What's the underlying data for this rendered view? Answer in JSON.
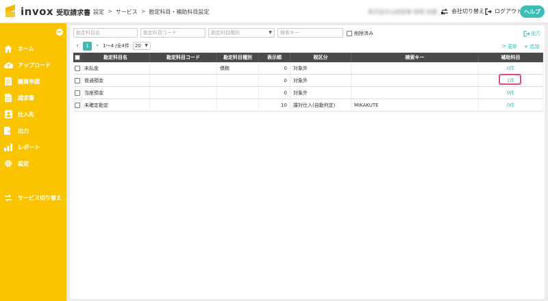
{
  "header": {
    "brand": "invox",
    "product": "受取請求書",
    "breadcrumb": [
      "設定",
      "サービス",
      "勘定科目・補助科目設定"
    ],
    "breadcrumb_sep": ">",
    "user_blurred": "株式会社山田商事  経理 佐藤",
    "company_switch": "会社切り替え",
    "logout": "ログアウト",
    "help": "ヘルプ"
  },
  "sidebar": {
    "collapse": "←",
    "items": [
      {
        "label": "ホーム",
        "icon": "home-icon"
      },
      {
        "label": "アップロード",
        "icon": "upload-cloud-icon"
      },
      {
        "label": "購買申請",
        "icon": "purchase-request-icon"
      },
      {
        "label": "請求書",
        "icon": "invoice-document-icon"
      },
      {
        "label": "仕入先",
        "icon": "supplier-icon"
      },
      {
        "label": "出力",
        "icon": "export-icon"
      },
      {
        "label": "レポート",
        "icon": "report-chart-icon"
      },
      {
        "label": "設定",
        "icon": "gear-icon"
      },
      {
        "label": "サービス切り替え",
        "icon": "service-switch-icon"
      }
    ]
  },
  "filters": {
    "name_placeholder": "勘定科目名",
    "code_placeholder": "勘定科目コード",
    "type_placeholder": "勘定科目種別",
    "key_placeholder": "検索キー",
    "deleted_label": "削除済み",
    "export_label": "出力"
  },
  "pager": {
    "current_page": "1",
    "range": "1〜4 /全4件",
    "per_page": "20",
    "refresh": "更新",
    "add": "追加"
  },
  "table": {
    "columns": [
      "勘定科目名",
      "勘定科目コード",
      "勘定科目種別",
      "表示順",
      "税区分",
      "検索キー",
      "補助科目"
    ],
    "rows": [
      {
        "name": "未払金",
        "code": "",
        "type": "債務",
        "order": "0",
        "tax": "対象外",
        "key": "",
        "sub": "0件"
      },
      {
        "name": "普通預金",
        "code": "",
        "type": "",
        "order": "0",
        "tax": "対象外",
        "key": "",
        "sub": "1件"
      },
      {
        "name": "当座預金",
        "code": "",
        "type": "",
        "order": "0",
        "tax": "対象外",
        "key": "",
        "sub": "0件"
      },
      {
        "name": "未確定勘定",
        "code": "",
        "type": "",
        "order": "10",
        "tax": "課対仕入(自動判定)",
        "key": "MIKAKUTE",
        "sub": "0件"
      }
    ]
  },
  "colors": {
    "sidebar": "#fac500",
    "accent": "#3dbdb5",
    "highlight": "#e8457a",
    "table_header": "#4a4a4a"
  }
}
